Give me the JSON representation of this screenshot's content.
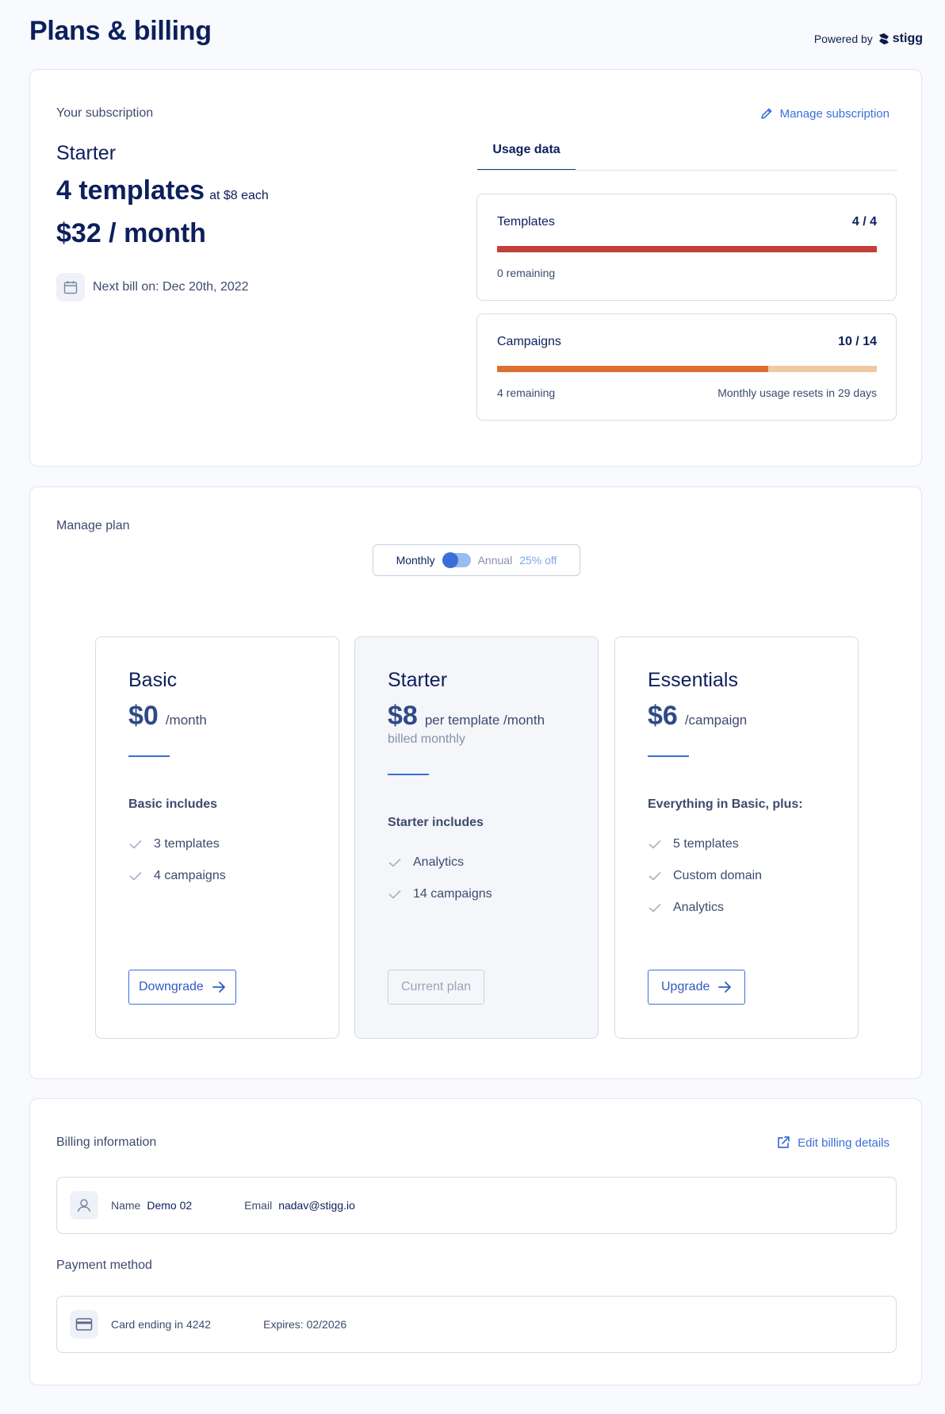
{
  "header": {
    "title": "Plans & billing",
    "powered_by": "Powered by",
    "brand": "stigg"
  },
  "subscription": {
    "section_label": "Your subscription",
    "manage_label": "Manage subscription",
    "plan_name": "Starter",
    "quantity": "4 templates",
    "quantity_suffix": "at $8 each",
    "price": "$32 / month",
    "next_bill": "Next bill on: Dec 20th, 2022",
    "usage_tab": "Usage data",
    "usage": [
      {
        "title": "Templates",
        "value": "4 / 4",
        "used": 4,
        "limit": 4,
        "remaining": "0 remaining",
        "reset": "",
        "fill_color": "#c2403a",
        "track_color": "#c2403a"
      },
      {
        "title": "Campaigns",
        "value": "10 / 14",
        "used": 10,
        "limit": 14,
        "remaining": "4 remaining",
        "reset": "Monthly usage resets in 29 days",
        "fill_color": "#dd6f33",
        "track_color": "#f1c8a6"
      }
    ]
  },
  "manage_plan": {
    "section_label": "Manage plan",
    "toggle": {
      "monthly": "Monthly",
      "annual": "Annual",
      "discount": "25% off",
      "selected": "Monthly"
    },
    "plans": [
      {
        "name": "Basic",
        "price": "$0",
        "unit": "/month",
        "sub": "",
        "includes_title": "Basic includes",
        "features": [
          "3 templates",
          "4 campaigns"
        ],
        "button": "Downgrade",
        "is_current": false
      },
      {
        "name": "Starter",
        "price": "$8",
        "unit": "per template /month",
        "sub": "billed monthly",
        "includes_title": "Starter includes",
        "features": [
          "Analytics",
          "14 campaigns"
        ],
        "button": "Current plan",
        "is_current": true
      },
      {
        "name": "Essentials",
        "price": "$6",
        "unit": "/campaign",
        "sub": "",
        "includes_title": "Everything in Basic, plus:",
        "features": [
          "5 templates",
          "Custom domain",
          "Analytics"
        ],
        "button": "Upgrade",
        "is_current": false
      }
    ]
  },
  "billing": {
    "section_label": "Billing information",
    "edit_label": "Edit billing details",
    "name_key": "Name",
    "name_value": "Demo 02",
    "email_key": "Email",
    "email_value": "nadav@stigg.io",
    "payment_label": "Payment method",
    "card": "Card ending in 4242",
    "expires": "Expires: 02/2026"
  },
  "colors": {
    "accent": "#3b6fd8",
    "primary_text": "#0d1f5c"
  }
}
